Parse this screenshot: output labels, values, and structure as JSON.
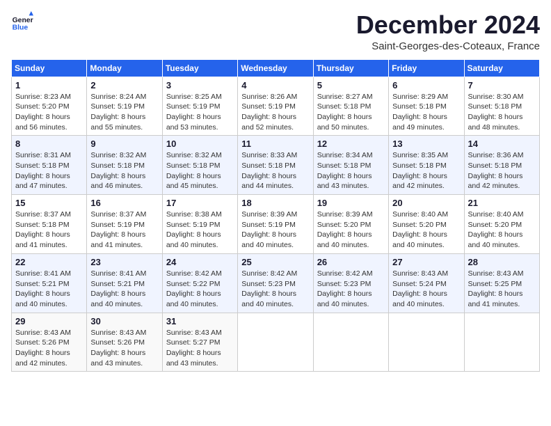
{
  "logo": {
    "general": "General",
    "blue": "Blue"
  },
  "header": {
    "month": "December 2024",
    "location": "Saint-Georges-des-Coteaux, France"
  },
  "days_of_week": [
    "Sunday",
    "Monday",
    "Tuesday",
    "Wednesday",
    "Thursday",
    "Friday",
    "Saturday"
  ],
  "weeks": [
    [
      {
        "day": "1",
        "sunrise": "8:23 AM",
        "sunset": "5:20 PM",
        "daylight": "8 hours and 56 minutes."
      },
      {
        "day": "2",
        "sunrise": "8:24 AM",
        "sunset": "5:19 PM",
        "daylight": "8 hours and 55 minutes."
      },
      {
        "day": "3",
        "sunrise": "8:25 AM",
        "sunset": "5:19 PM",
        "daylight": "8 hours and 53 minutes."
      },
      {
        "day": "4",
        "sunrise": "8:26 AM",
        "sunset": "5:19 PM",
        "daylight": "8 hours and 52 minutes."
      },
      {
        "day": "5",
        "sunrise": "8:27 AM",
        "sunset": "5:18 PM",
        "daylight": "8 hours and 50 minutes."
      },
      {
        "day": "6",
        "sunrise": "8:29 AM",
        "sunset": "5:18 PM",
        "daylight": "8 hours and 49 minutes."
      },
      {
        "day": "7",
        "sunrise": "8:30 AM",
        "sunset": "5:18 PM",
        "daylight": "8 hours and 48 minutes."
      }
    ],
    [
      {
        "day": "8",
        "sunrise": "8:31 AM",
        "sunset": "5:18 PM",
        "daylight": "8 hours and 47 minutes."
      },
      {
        "day": "9",
        "sunrise": "8:32 AM",
        "sunset": "5:18 PM",
        "daylight": "8 hours and 46 minutes."
      },
      {
        "day": "10",
        "sunrise": "8:32 AM",
        "sunset": "5:18 PM",
        "daylight": "8 hours and 45 minutes."
      },
      {
        "day": "11",
        "sunrise": "8:33 AM",
        "sunset": "5:18 PM",
        "daylight": "8 hours and 44 minutes."
      },
      {
        "day": "12",
        "sunrise": "8:34 AM",
        "sunset": "5:18 PM",
        "daylight": "8 hours and 43 minutes."
      },
      {
        "day": "13",
        "sunrise": "8:35 AM",
        "sunset": "5:18 PM",
        "daylight": "8 hours and 42 minutes."
      },
      {
        "day": "14",
        "sunrise": "8:36 AM",
        "sunset": "5:18 PM",
        "daylight": "8 hours and 42 minutes."
      }
    ],
    [
      {
        "day": "15",
        "sunrise": "8:37 AM",
        "sunset": "5:18 PM",
        "daylight": "8 hours and 41 minutes."
      },
      {
        "day": "16",
        "sunrise": "8:37 AM",
        "sunset": "5:19 PM",
        "daylight": "8 hours and 41 minutes."
      },
      {
        "day": "17",
        "sunrise": "8:38 AM",
        "sunset": "5:19 PM",
        "daylight": "8 hours and 40 minutes."
      },
      {
        "day": "18",
        "sunrise": "8:39 AM",
        "sunset": "5:19 PM",
        "daylight": "8 hours and 40 minutes."
      },
      {
        "day": "19",
        "sunrise": "8:39 AM",
        "sunset": "5:20 PM",
        "daylight": "8 hours and 40 minutes."
      },
      {
        "day": "20",
        "sunrise": "8:40 AM",
        "sunset": "5:20 PM",
        "daylight": "8 hours and 40 minutes."
      },
      {
        "day": "21",
        "sunrise": "8:40 AM",
        "sunset": "5:20 PM",
        "daylight": "8 hours and 40 minutes."
      }
    ],
    [
      {
        "day": "22",
        "sunrise": "8:41 AM",
        "sunset": "5:21 PM",
        "daylight": "8 hours and 40 minutes."
      },
      {
        "day": "23",
        "sunrise": "8:41 AM",
        "sunset": "5:21 PM",
        "daylight": "8 hours and 40 minutes."
      },
      {
        "day": "24",
        "sunrise": "8:42 AM",
        "sunset": "5:22 PM",
        "daylight": "8 hours and 40 minutes."
      },
      {
        "day": "25",
        "sunrise": "8:42 AM",
        "sunset": "5:23 PM",
        "daylight": "8 hours and 40 minutes."
      },
      {
        "day": "26",
        "sunrise": "8:42 AM",
        "sunset": "5:23 PM",
        "daylight": "8 hours and 40 minutes."
      },
      {
        "day": "27",
        "sunrise": "8:43 AM",
        "sunset": "5:24 PM",
        "daylight": "8 hours and 40 minutes."
      },
      {
        "day": "28",
        "sunrise": "8:43 AM",
        "sunset": "5:25 PM",
        "daylight": "8 hours and 41 minutes."
      }
    ],
    [
      {
        "day": "29",
        "sunrise": "8:43 AM",
        "sunset": "5:26 PM",
        "daylight": "8 hours and 42 minutes."
      },
      {
        "day": "30",
        "sunrise": "8:43 AM",
        "sunset": "5:26 PM",
        "daylight": "8 hours and 43 minutes."
      },
      {
        "day": "31",
        "sunrise": "8:43 AM",
        "sunset": "5:27 PM",
        "daylight": "8 hours and 43 minutes."
      },
      null,
      null,
      null,
      null
    ]
  ],
  "labels": {
    "sunrise": "Sunrise:",
    "sunset": "Sunset:",
    "daylight": "Daylight hours"
  }
}
